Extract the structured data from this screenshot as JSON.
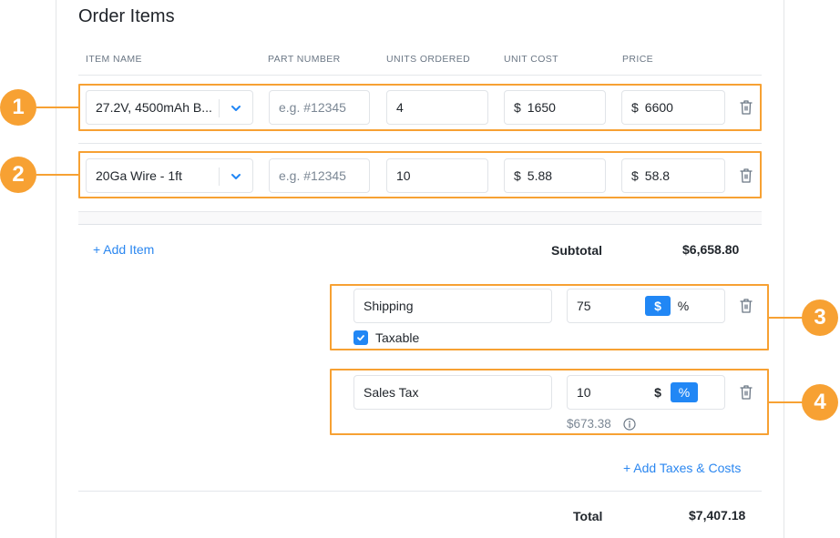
{
  "section": {
    "title": "Order Items"
  },
  "columns": [
    "ITEM NAME",
    "PART NUMBER",
    "UNITS ORDERED",
    "UNIT COST",
    "PRICE"
  ],
  "items": [
    {
      "name": "27.2V, 4500mAh B...",
      "part_number_placeholder": "e.g. #12345",
      "units": "4",
      "currency": "$",
      "unit_cost": "1650",
      "price": "6600",
      "callout": "1"
    },
    {
      "name": "20Ga Wire - 1ft",
      "part_number_placeholder": "e.g. #12345",
      "units": "10",
      "currency": "$",
      "unit_cost": "5.88",
      "price": "58.8",
      "callout": "2"
    }
  ],
  "add_item_label": "+ Add Item",
  "subtotal": {
    "label": "Subtotal",
    "value": "$6,658.80"
  },
  "costs": [
    {
      "name": "Shipping",
      "amount": "75",
      "mode_dollar": "$",
      "mode_percent": "%",
      "active_mode": "$",
      "taxable_label": "Taxable",
      "taxable_checked": true,
      "callout": "3"
    },
    {
      "name": "Sales Tax",
      "amount": "10",
      "mode_dollar": "$",
      "mode_percent": "%",
      "active_mode": "%",
      "computed": "$673.38",
      "callout": "4"
    }
  ],
  "add_costs_label": "+ Add Taxes & Costs",
  "total": {
    "label": "Total",
    "value": "$7,407.18"
  },
  "colors": {
    "accent": "#2187f5",
    "callout": "#f7a133",
    "link": "#2b87f0"
  }
}
